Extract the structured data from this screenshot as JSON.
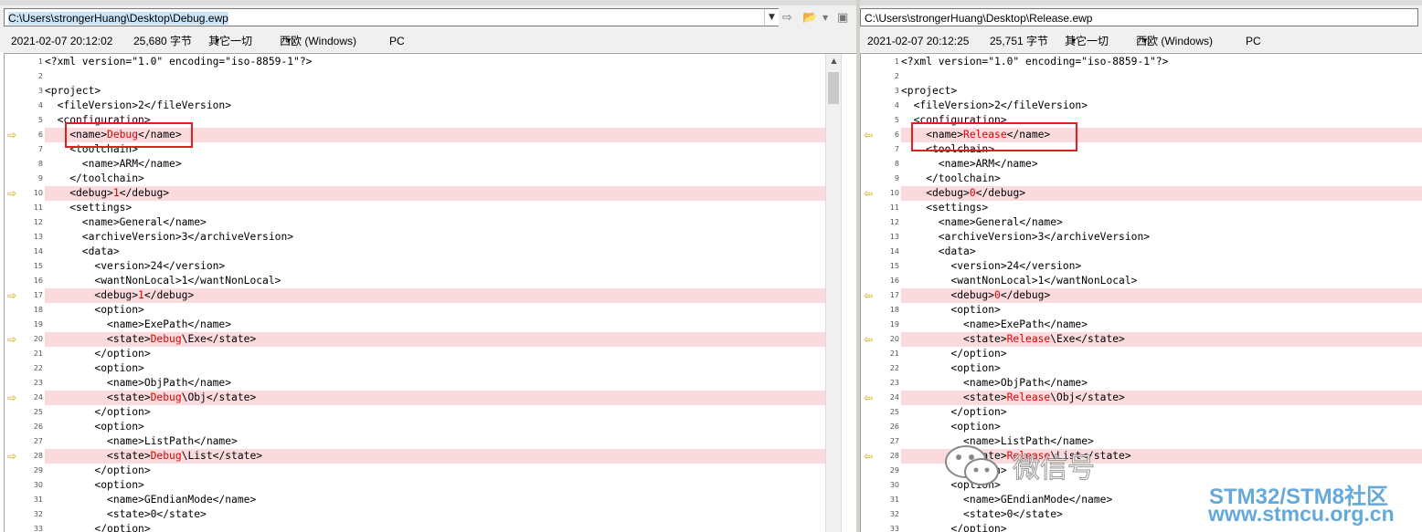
{
  "colors": {
    "diff_bg": "#fadadd",
    "diff_text": "#e00000",
    "arrow": "#d9a400",
    "annotation_box": "#e02020",
    "brand": "#4a9bd4"
  },
  "left": {
    "path": "C:\\Users\\strongerHuang\\Desktop\\Debug.ewp",
    "info": {
      "datetime": "2021-02-07 20:12:02",
      "size": "25,680 字节",
      "type": "其它一切",
      "encoding": "西欧 (Windows)",
      "lineend": "PC"
    },
    "lines": [
      {
        "n": "1",
        "pre": "<?xml version=\"1.0\" encoding=\"iso-8859-1\"?>",
        "diff": false
      },
      {
        "n": "2",
        "pre": "",
        "diff": false
      },
      {
        "n": "3",
        "pre": "<project>",
        "diff": false
      },
      {
        "n": "4",
        "pre": "  <fileVersion>2</fileVersion>",
        "diff": false
      },
      {
        "n": "5",
        "pre": "  <configuration>",
        "diff": false
      },
      {
        "n": "6",
        "pre": "    <name>",
        "red": "Debug",
        "post": "</name>",
        "diff": true
      },
      {
        "n": "7",
        "pre": "    <toolchain>",
        "diff": false
      },
      {
        "n": "8",
        "pre": "      <name>ARM</name>",
        "diff": false
      },
      {
        "n": "9",
        "pre": "    </toolchain>",
        "diff": false
      },
      {
        "n": "10",
        "pre": "    <debug>",
        "red": "1",
        "post": "</debug>",
        "diff": true
      },
      {
        "n": "11",
        "pre": "    <settings>",
        "diff": false
      },
      {
        "n": "12",
        "pre": "      <name>General</name>",
        "diff": false
      },
      {
        "n": "13",
        "pre": "      <archiveVersion>3</archiveVersion>",
        "diff": false
      },
      {
        "n": "14",
        "pre": "      <data>",
        "diff": false
      },
      {
        "n": "15",
        "pre": "        <version>24</version>",
        "diff": false
      },
      {
        "n": "16",
        "pre": "        <wantNonLocal>1</wantNonLocal>",
        "diff": false
      },
      {
        "n": "17",
        "pre": "        <debug>",
        "red": "1",
        "post": "</debug>",
        "diff": true
      },
      {
        "n": "18",
        "pre": "        <option>",
        "diff": false
      },
      {
        "n": "19",
        "pre": "          <name>ExePath</name>",
        "diff": false
      },
      {
        "n": "20",
        "pre": "          <state>",
        "red": "Debug",
        "post": "\\Exe</state>",
        "diff": true
      },
      {
        "n": "21",
        "pre": "        </option>",
        "diff": false
      },
      {
        "n": "22",
        "pre": "        <option>",
        "diff": false
      },
      {
        "n": "23",
        "pre": "          <name>ObjPath</name>",
        "diff": false
      },
      {
        "n": "24",
        "pre": "          <state>",
        "red": "Debug",
        "post": "\\Obj</state>",
        "diff": true
      },
      {
        "n": "25",
        "pre": "        </option>",
        "diff": false
      },
      {
        "n": "26",
        "pre": "        <option>",
        "diff": false
      },
      {
        "n": "27",
        "pre": "          <name>ListPath</name>",
        "diff": false
      },
      {
        "n": "28",
        "pre": "          <state>",
        "red": "Debug",
        "post": "\\List</state>",
        "diff": true
      },
      {
        "n": "29",
        "pre": "        </option>",
        "diff": false
      },
      {
        "n": "30",
        "pre": "        <option>",
        "diff": false
      },
      {
        "n": "31",
        "pre": "          <name>GEndianMode</name>",
        "diff": false
      },
      {
        "n": "32",
        "pre": "          <state>0</state>",
        "diff": false
      },
      {
        "n": "33",
        "pre": "        </option>",
        "diff": false
      }
    ]
  },
  "right": {
    "path": "C:\\Users\\strongerHuang\\Desktop\\Release.ewp",
    "info": {
      "datetime": "2021-02-07 20:12:25",
      "size": "25,751 字节",
      "type": "其它一切",
      "encoding": "西欧 (Windows)",
      "lineend": "PC"
    },
    "lines": [
      {
        "n": "1",
        "pre": "<?xml version=\"1.0\" encoding=\"iso-8859-1\"?>",
        "diff": false
      },
      {
        "n": "2",
        "pre": "",
        "diff": false
      },
      {
        "n": "3",
        "pre": "<project>",
        "diff": false
      },
      {
        "n": "4",
        "pre": "  <fileVersion>2</fileVersion>",
        "diff": false
      },
      {
        "n": "5",
        "pre": "  <configuration>",
        "diff": false
      },
      {
        "n": "6",
        "pre": "    <name>",
        "red": "Release",
        "post": "</name>",
        "diff": true
      },
      {
        "n": "7",
        "pre": "    <toolchain>",
        "diff": false
      },
      {
        "n": "8",
        "pre": "      <name>ARM</name>",
        "diff": false
      },
      {
        "n": "9",
        "pre": "    </toolchain>",
        "diff": false
      },
      {
        "n": "10",
        "pre": "    <debug>",
        "red": "0",
        "post": "</debug>",
        "diff": true
      },
      {
        "n": "11",
        "pre": "    <settings>",
        "diff": false
      },
      {
        "n": "12",
        "pre": "      <name>General</name>",
        "diff": false
      },
      {
        "n": "13",
        "pre": "      <archiveVersion>3</archiveVersion>",
        "diff": false
      },
      {
        "n": "14",
        "pre": "      <data>",
        "diff": false
      },
      {
        "n": "15",
        "pre": "        <version>24</version>",
        "diff": false
      },
      {
        "n": "16",
        "pre": "        <wantNonLocal>1</wantNonLocal>",
        "diff": false
      },
      {
        "n": "17",
        "pre": "        <debug>",
        "red": "0",
        "post": "</debug>",
        "diff": true
      },
      {
        "n": "18",
        "pre": "        <option>",
        "diff": false
      },
      {
        "n": "19",
        "pre": "          <name>ExePath</name>",
        "diff": false
      },
      {
        "n": "20",
        "pre": "          <state>",
        "red": "Release",
        "post": "\\Exe</state>",
        "diff": true
      },
      {
        "n": "21",
        "pre": "        </option>",
        "diff": false
      },
      {
        "n": "22",
        "pre": "        <option>",
        "diff": false
      },
      {
        "n": "23",
        "pre": "          <name>ObjPath</name>",
        "diff": false
      },
      {
        "n": "24",
        "pre": "          <state>",
        "red": "Release",
        "post": "\\Obj</state>",
        "diff": true
      },
      {
        "n": "25",
        "pre": "        </option>",
        "diff": false
      },
      {
        "n": "26",
        "pre": "        <option>",
        "diff": false
      },
      {
        "n": "27",
        "pre": "          <name>ListPath</name>",
        "diff": false
      },
      {
        "n": "28",
        "pre": "          <state>",
        "red": "Release",
        "post": "\\List</state>",
        "diff": true
      },
      {
        "n": "29",
        "pre": "        </option>",
        "diff": false
      },
      {
        "n": "30",
        "pre": "        <option>",
        "diff": false
      },
      {
        "n": "31",
        "pre": "          <name>GEndianMode</name>",
        "diff": false
      },
      {
        "n": "32",
        "pre": "          <state>0</state>",
        "diff": false
      },
      {
        "n": "33",
        "pre": "        </option>",
        "diff": false
      }
    ]
  },
  "watermark": {
    "wechat": "微信号",
    "brand1": "STM32/STM8社区",
    "brand2": "www.stmcu.org.cn",
    "icon": "wechat-icon"
  },
  "icons": {
    "dropdown": "chevron-down-icon",
    "sync": "sync-arrows-icon",
    "open": "folder-open-icon",
    "save": "save-icon",
    "diff_marker": "diff-arrow-icon"
  }
}
